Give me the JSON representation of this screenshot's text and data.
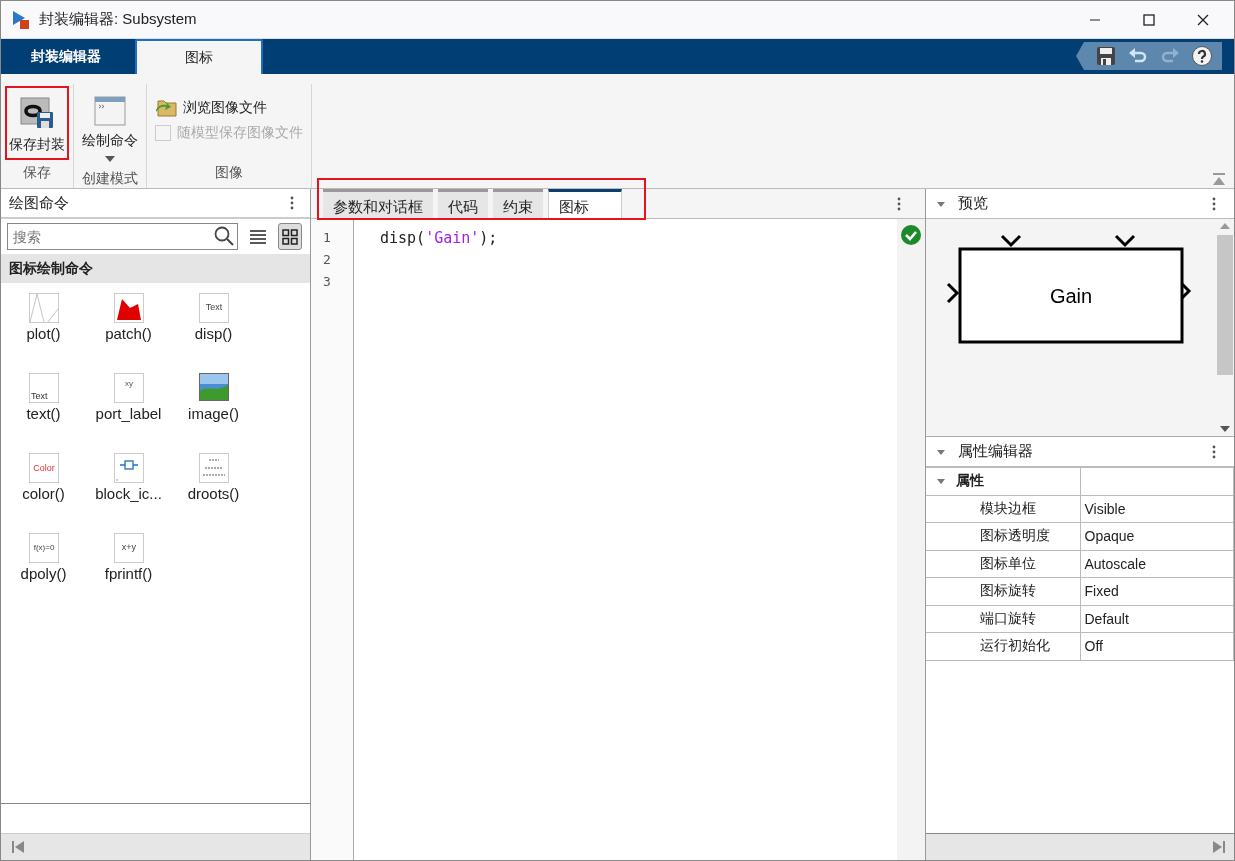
{
  "window": {
    "title": "封装编辑器: Subsystem"
  },
  "ribbon_tabs": [
    {
      "label": "封装编辑器",
      "selected": false
    },
    {
      "label": "图标",
      "selected": true
    }
  ],
  "quick_access": [
    {
      "kind": "save",
      "disabled": false
    },
    {
      "kind": "undo",
      "disabled": false
    },
    {
      "kind": "redo",
      "disabled": true
    },
    {
      "kind": "help",
      "disabled": false
    }
  ],
  "ribbon_groups": [
    {
      "label": "保存",
      "items": [
        {
          "kind": "save",
          "label": "保存封装",
          "highlighted": true
        }
      ]
    },
    {
      "label": "创建模式",
      "items": [
        {
          "kind": "draw",
          "label": "绘制命令",
          "dropdown": true
        }
      ]
    },
    {
      "label": "图像",
      "items": [
        {
          "kind": "browse",
          "label": "浏览图像文件"
        },
        {
          "kind": "checkbox",
          "label": "随模型保存图像文件",
          "checked": false,
          "disabled": true
        }
      ]
    }
  ],
  "commands_panel": {
    "title": "绘图命令",
    "search": {
      "placeholder": "搜索"
    },
    "views": [
      {
        "kind": "list",
        "selected": false
      },
      {
        "kind": "grid",
        "selected": true
      }
    ],
    "section": "图标绘制命令",
    "commands": [
      {
        "kind": "plot",
        "label": "plot()"
      },
      {
        "kind": "patch",
        "label": "patch()"
      },
      {
        "kind": "text",
        "label": "disp()",
        "thumb_text": "Text"
      },
      {
        "kind": "text-low",
        "label": "text()",
        "thumb_text": "Text"
      },
      {
        "kind": "port",
        "label": "port_label",
        "thumb_text": "xy"
      },
      {
        "kind": "image",
        "label": "image()"
      },
      {
        "kind": "color",
        "label": "color()",
        "thumb_text": "Color"
      },
      {
        "kind": "block",
        "label": "block_ic..."
      },
      {
        "kind": "droots",
        "label": "droots()"
      },
      {
        "kind": "text",
        "label": "dpoly()",
        "thumb_text": "f(x)=0"
      },
      {
        "kind": "text",
        "label": "fprintf()",
        "thumb_text": "x+y"
      }
    ]
  },
  "editor": {
    "tabs_highlighted": true,
    "tabs": [
      {
        "label": "参数和对话框",
        "selected": false
      },
      {
        "label": "代码",
        "selected": false
      },
      {
        "label": "约束",
        "selected": false
      },
      {
        "label": "图标",
        "selected": true
      }
    ],
    "lines": [
      {
        "number": "1",
        "tokens": [
          {
            "kind": "plain",
            "text": "disp("
          },
          {
            "kind": "string",
            "text": "'Gain'"
          },
          {
            "kind": "plain",
            "text": ");"
          }
        ]
      },
      {
        "number": "2"
      },
      {
        "number": "3"
      }
    ],
    "valid": true
  },
  "preview": {
    "title": "预览",
    "expanded": true,
    "block_label": "Gain"
  },
  "property_editor": {
    "title": "属性编辑器",
    "expanded": true,
    "group": {
      "label": "属性",
      "expanded": true
    },
    "rows": [
      {
        "name": "模块边框",
        "value": "Visible"
      },
      {
        "name": "图标透明度",
        "value": "Opaque"
      },
      {
        "name": "图标单位",
        "value": "Autoscale"
      },
      {
        "name": "图标旋转",
        "value": "Fixed"
      },
      {
        "name": "端口旋转",
        "value": "Default"
      },
      {
        "name": "运行初始化",
        "value": "Off"
      }
    ]
  }
}
